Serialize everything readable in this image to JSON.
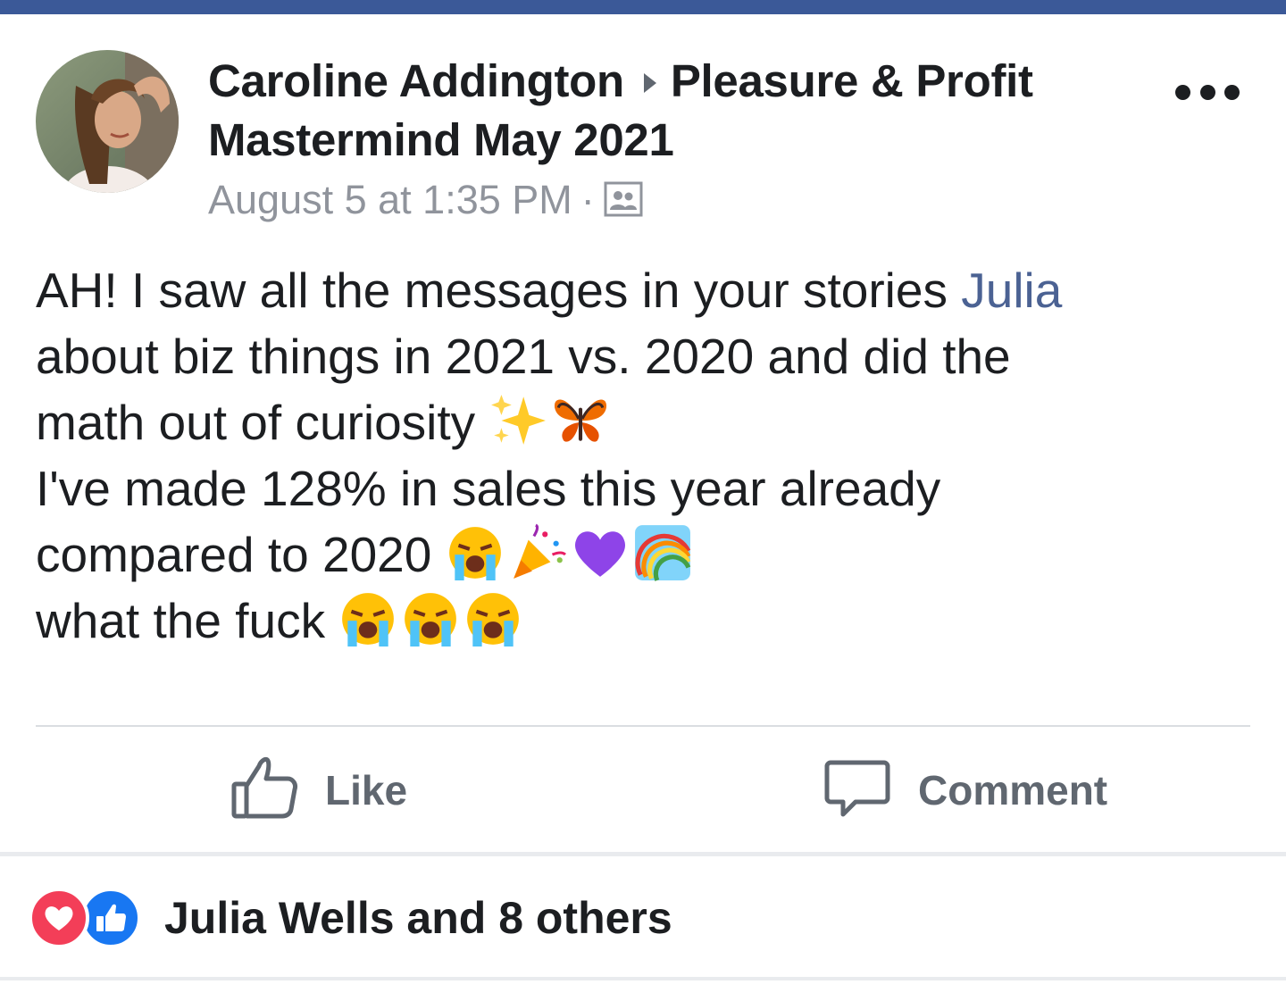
{
  "post": {
    "author": "Caroline Addington",
    "group": "Pleasure & Profit",
    "group_line2": "Mastermind May 2021",
    "timestamp": "August 5 at 1:35 PM",
    "separator": "·",
    "audience_icon": "group-members-icon",
    "text": {
      "line1_prefix": "AH! I saw all the messages in your stories ",
      "line1_mention": "Julia",
      "line2": "about biz things in 2021 vs. 2020 and did the",
      "line3": "math out of curiosity",
      "line3_emojis": [
        "sparkles",
        "butterfly"
      ],
      "line4": "I've made 128% in sales this year already",
      "line5": "compared to 2020",
      "line5_emojis": [
        "loudly-crying-face",
        "party-popper",
        "purple-heart",
        "rainbow"
      ],
      "line6": "what the fuck",
      "line6_emojis": [
        "loudly-crying-face",
        "loudly-crying-face",
        "loudly-crying-face"
      ]
    }
  },
  "actions": {
    "like_label": "Like",
    "comment_label": "Comment"
  },
  "reactions": {
    "icons": [
      "love-reaction-icon",
      "like-reaction-icon"
    ],
    "summary": "Julia Wells and 8 others"
  },
  "colors": {
    "top_bar": "#3b5998",
    "mention": "#4b6293",
    "secondary_text": "#90949c",
    "action_text": "#606770",
    "love": "#f33e58",
    "like": "#1877f2"
  }
}
